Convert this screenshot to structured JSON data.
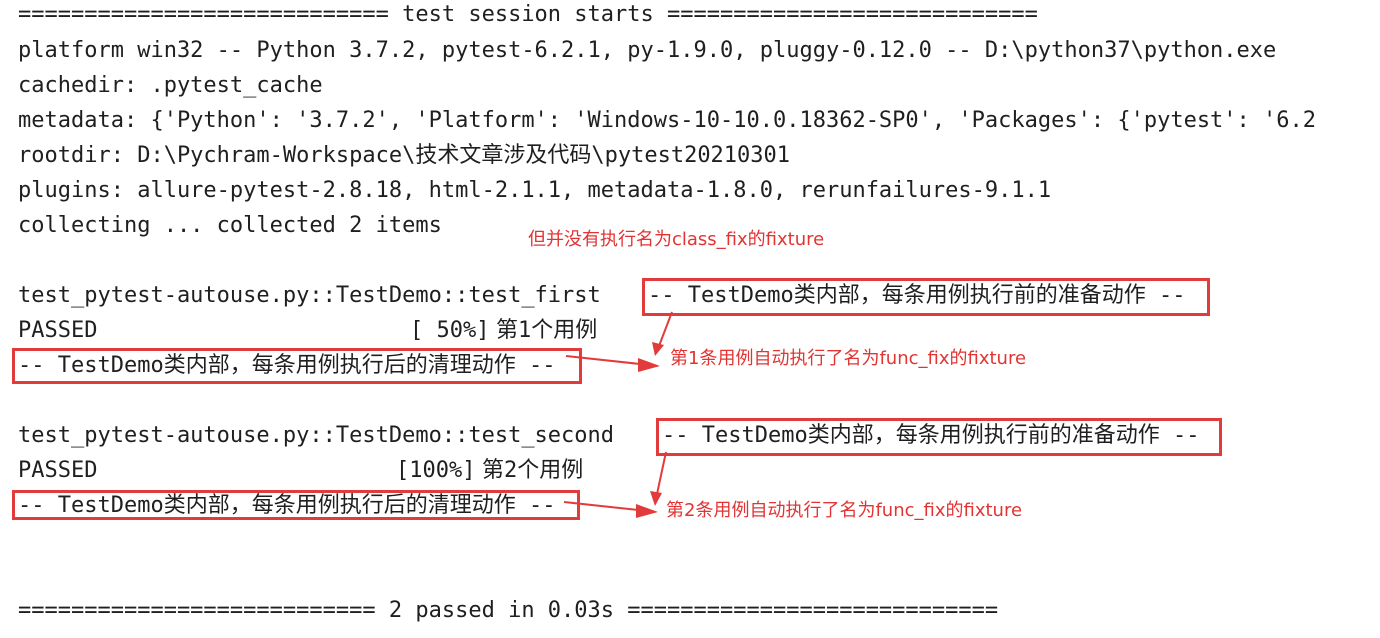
{
  "header": {
    "session_start": "============================ test session starts ============================",
    "platform": "platform win32 -- Python 3.7.2, pytest-6.2.1, py-1.9.0, pluggy-0.12.0 -- D:\\python37\\python.exe",
    "cachedir": "cachedir: .pytest_cache",
    "metadata": "metadata: {'Python': '3.7.2', 'Platform': 'Windows-10-10.0.18362-SP0', 'Packages': {'pytest': '6.2",
    "rootdir": "rootdir: D:\\Pychram-Workspace\\技术文章涉及代码\\pytest20210301",
    "plugins": "plugins: allure-pytest-2.8.18, html-2.1.1, metadata-1.8.0, rerunfailures-9.1.1",
    "collecting": "collecting ... collected 2 items"
  },
  "annotations": {
    "no_class_fix": "但并没有执行名为class_fix的fixture",
    "first_case": "第1条用例自动执行了名为func_fix的fixture",
    "second_case": "第2条用例自动执行了名为func_fix的fixture"
  },
  "tests": [
    {
      "nodeid": "test_pytest-autouse.py::TestDemo::test_first",
      "setup": "-- TestDemo类内部，每条用例执行前的准备动作 --",
      "status": "PASSED",
      "progress": "[ 50%]",
      "output": "第1个用例",
      "teardown": "-- TestDemo类内部，每条用例执行后的清理动作 --"
    },
    {
      "nodeid": "test_pytest-autouse.py::TestDemo::test_second",
      "setup": "-- TestDemo类内部，每条用例执行前的准备动作 --",
      "status": "PASSED",
      "progress": "[100%]",
      "output": "第2个用例",
      "teardown": "-- TestDemo类内部，每条用例执行后的清理动作 --"
    }
  ],
  "footer": {
    "summary": "=========================== 2 passed in 0.03s ============================"
  },
  "colors": {
    "text": "#1f1f1f",
    "annotation": "#e33333",
    "box": "#e23b3b"
  }
}
